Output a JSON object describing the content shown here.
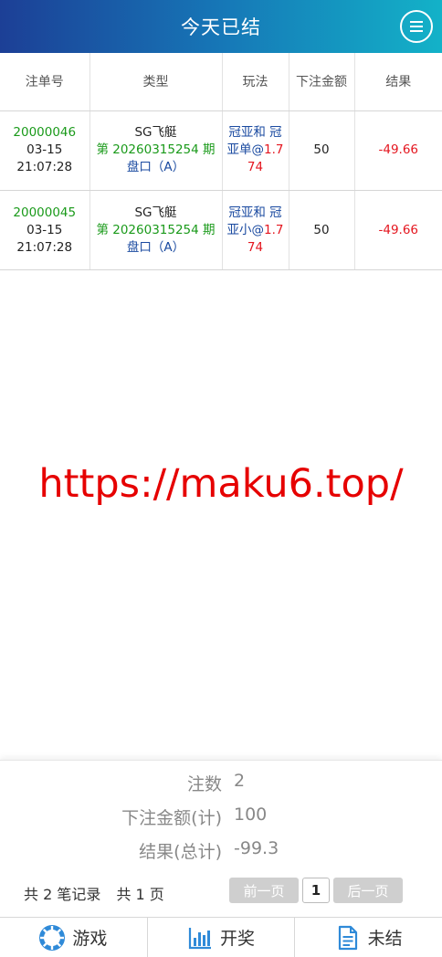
{
  "header": {
    "title": "今天已结"
  },
  "table": {
    "columns": [
      "注单号",
      "类型",
      "玩法",
      "下注金额",
      "结果"
    ],
    "rows": [
      {
        "bet_id": "20000046",
        "date": "03-15",
        "time": "21:07:28",
        "game": "SG飞艇",
        "issue_prefix": "第 ",
        "issue": "20260315254",
        "issue_suffix": " 期",
        "market": "盘口（A）",
        "play": "冠亚和 冠亚单",
        "odds_prefix": "@",
        "odds": "1.774",
        "amount": "50",
        "result": "-49.66"
      },
      {
        "bet_id": "20000045",
        "date": "03-15",
        "time": "21:07:28",
        "game": "SG飞艇",
        "issue_prefix": "第 ",
        "issue": "20260315254",
        "issue_suffix": " 期",
        "market": "盘口（A）",
        "play": "冠亚和 冠亚小",
        "odds_prefix": "@",
        "odds": "1.774",
        "amount": "50",
        "result": "-49.66"
      }
    ]
  },
  "watermark": "https://maku6.top/",
  "summary": {
    "count_label": "注数",
    "count_value": "2",
    "amount_label": "下注金额(计)",
    "amount_value": "100",
    "result_label": "结果(总计)",
    "result_value": "-99.3"
  },
  "pager": {
    "records": "共 2 笔记录",
    "pages": "共 1 页",
    "prev": "前一页",
    "current": "1",
    "next": "后一页"
  },
  "tabs": [
    {
      "label": "游戏",
      "icon": "lifebuoy-icon"
    },
    {
      "label": "开奖",
      "icon": "bar-chart-icon"
    },
    {
      "label": "未结",
      "icon": "document-icon"
    }
  ],
  "colors": {
    "accent_left": "#1c3f96",
    "accent_right": "#13b2c8",
    "win": "#1a9a1a",
    "loss": "#e4161f",
    "link": "#1a4aa0"
  }
}
